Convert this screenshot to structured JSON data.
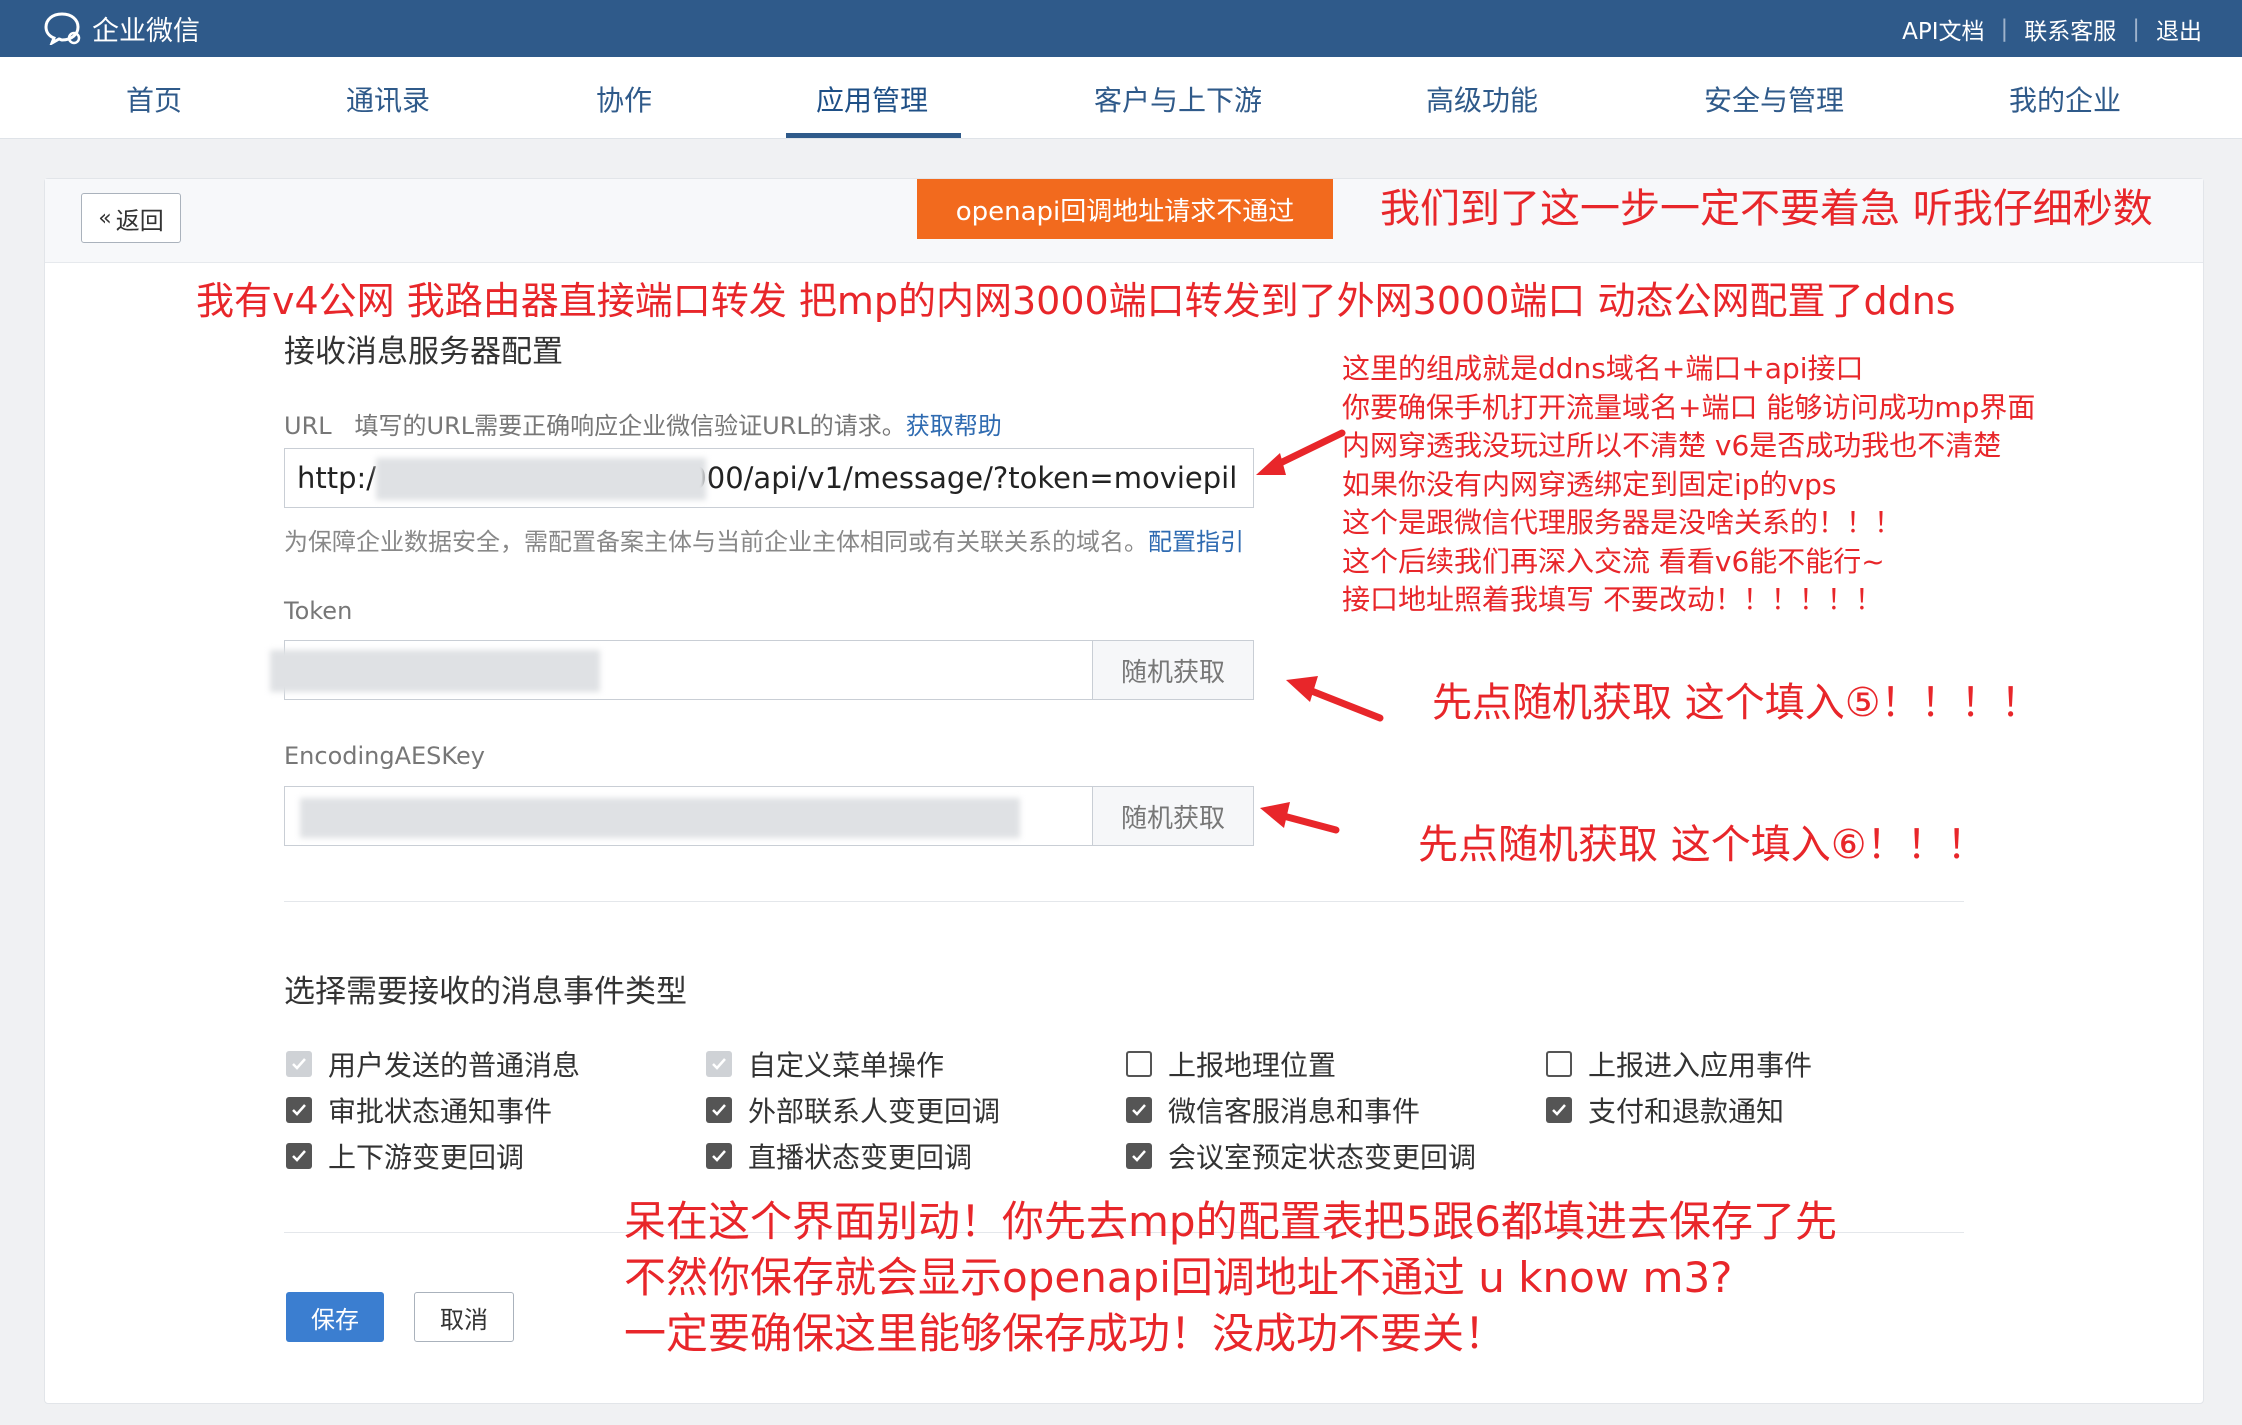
{
  "colors": {
    "topbar": "#2f5a8a",
    "accent": "#2f6bb1",
    "alert": "#f26a1e",
    "annotation": "#e8262a"
  },
  "topbar": {
    "brand": "企业微信",
    "links": [
      "API文档",
      "联系客服",
      "退出"
    ]
  },
  "nav": {
    "items": [
      "首页",
      "通讯录",
      "协作",
      "应用管理",
      "客户与上下游",
      "高级功能",
      "安全与管理",
      "我的企业"
    ],
    "active": "应用管理"
  },
  "card": {
    "back_label": "返回",
    "alert": "openapi回调地址请求不通过",
    "section_title": "接收消息服务器配置",
    "url_label": "URL",
    "url_desc": "填写的URL需要正确响应企业微信验证URL的请求。",
    "url_help": "获取帮助",
    "url_prefix": "http:/",
    "url_value": ":3000/api/v1/message/?token=moviepil",
    "url_hint": "为保障企业数据安全，需配置备案主体与当前企业主体相同或有关联关系的域名。",
    "url_hint_link": "配置指引",
    "token_label": "Token",
    "aes_label": "EncodingAESKey",
    "random_button": "随机获取",
    "events_title": "选择需要接收的消息事件类型",
    "events": [
      {
        "label": "用户发送的普通消息",
        "state": "disabled"
      },
      {
        "label": "自定义菜单操作",
        "state": "disabled"
      },
      {
        "label": "上报地理位置",
        "state": "unchecked"
      },
      {
        "label": "上报进入应用事件",
        "state": "unchecked"
      },
      {
        "label": "审批状态通知事件",
        "state": "checked"
      },
      {
        "label": "外部联系人变更回调",
        "state": "checked"
      },
      {
        "label": "微信客服消息和事件",
        "state": "checked"
      },
      {
        "label": "支付和退款通知",
        "state": "checked"
      },
      {
        "label": "上下游变更回调",
        "state": "checked"
      },
      {
        "label": "直播状态变更回调",
        "state": "checked"
      },
      {
        "label": "会议室预定状态变更回调",
        "state": "checked"
      }
    ],
    "save_label": "保存",
    "cancel_label": "取消"
  },
  "annotations": {
    "top_right": "我们到了这一步一定不要着急 听我仔细秒数",
    "network": "我有v4公网 我路由器直接端口转发 把mp的内网3000端口转发到了外网3000端口 动态公网配置了ddns",
    "url_notes": [
      "这里的组成就是ddns域名+端口+api接口",
      "你要确保手机打开流量域名+端口 能够访问成功mp界面",
      "内网穿透我没玩过所以不清楚 v6是否成功我也不清楚",
      "如果你没有内网穿透绑定到固定ip的vps",
      "这个是跟微信代理服务器是没啥关系的！！！",
      "这个后续我们再深入交流 看看v6能不能行~",
      "接口地址照着我填写 不要改动！！！！！！"
    ],
    "token_note": "先点随机获取 这个填入⑤！！！！",
    "aes_note": "先点随机获取 这个填入⑥！！！",
    "bottom_notes": [
      "呆在这个界面别动！你先去mp的配置表把5跟6都填进去保存了先",
      "不然你保存就会显示openapi回调地址不通过 u know m3?",
      "一定要确保这里能够保存成功！没成功不要关！"
    ]
  }
}
